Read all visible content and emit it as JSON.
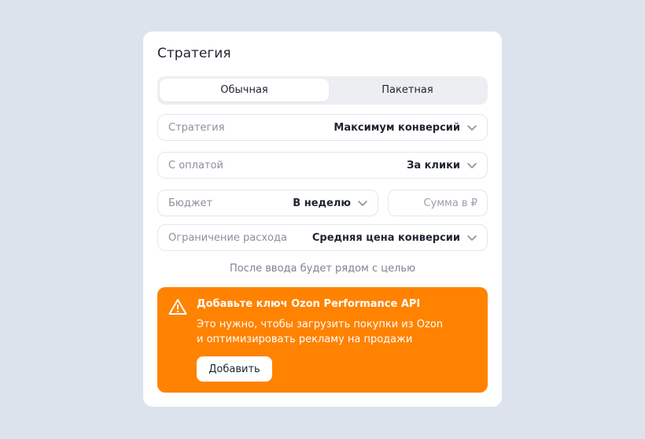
{
  "card": {
    "title": "Стратегия",
    "tabs": [
      {
        "label": "Обычная",
        "active": true
      },
      {
        "label": "Пакетная",
        "active": false
      }
    ],
    "fields": {
      "strategy": {
        "label": "Стратегия",
        "value": "Максимум конверсий"
      },
      "payment": {
        "label": "С оплатой",
        "value": "За клики"
      },
      "budget": {
        "label": "Бюджет",
        "value": "В неделю"
      },
      "amount": {
        "placeholder": "Сумма в ₽"
      },
      "limit": {
        "label": "Ограничение расхода",
        "value": "Средняя цена конверсии"
      }
    },
    "hint": "После ввода будет рядом с целью"
  },
  "alert": {
    "title": "Добавьте ключ Ozon Performance API",
    "text_line1": "Это нужно, чтобы загрузить покупки из Ozon",
    "text_line2": "и оптимизировать рекламу на продажи",
    "button": "Добавить",
    "icon": "warning-icon"
  },
  "colors": {
    "background": "#dde3ed",
    "accent": "#ff8200",
    "text": "#1f2430",
    "muted": "#8a909c"
  }
}
